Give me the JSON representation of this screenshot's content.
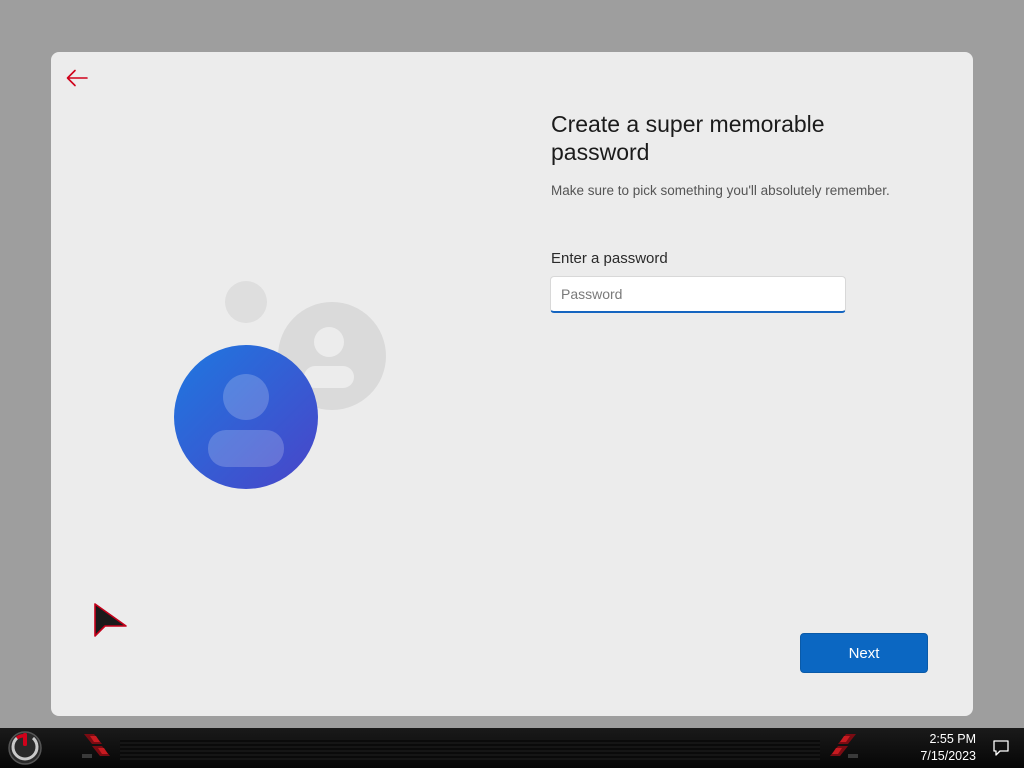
{
  "dialog": {
    "title": "Create a super memorable password",
    "subtitle": "Make sure to pick something you'll absolutely remember.",
    "field_label": "Enter a password",
    "password_placeholder": "Password",
    "password_value": "",
    "next_label": "Next",
    "back_icon": "arrow-left-icon"
  },
  "taskbar": {
    "time": "2:55 PM",
    "date": "7/15/2023",
    "start_icon": "power-ring-icon",
    "notification_icon": "speech-bubble-icon"
  },
  "colors": {
    "accent": "#0b67c2",
    "back_arrow": "#d0021b",
    "dialog_bg": "#ececec"
  }
}
